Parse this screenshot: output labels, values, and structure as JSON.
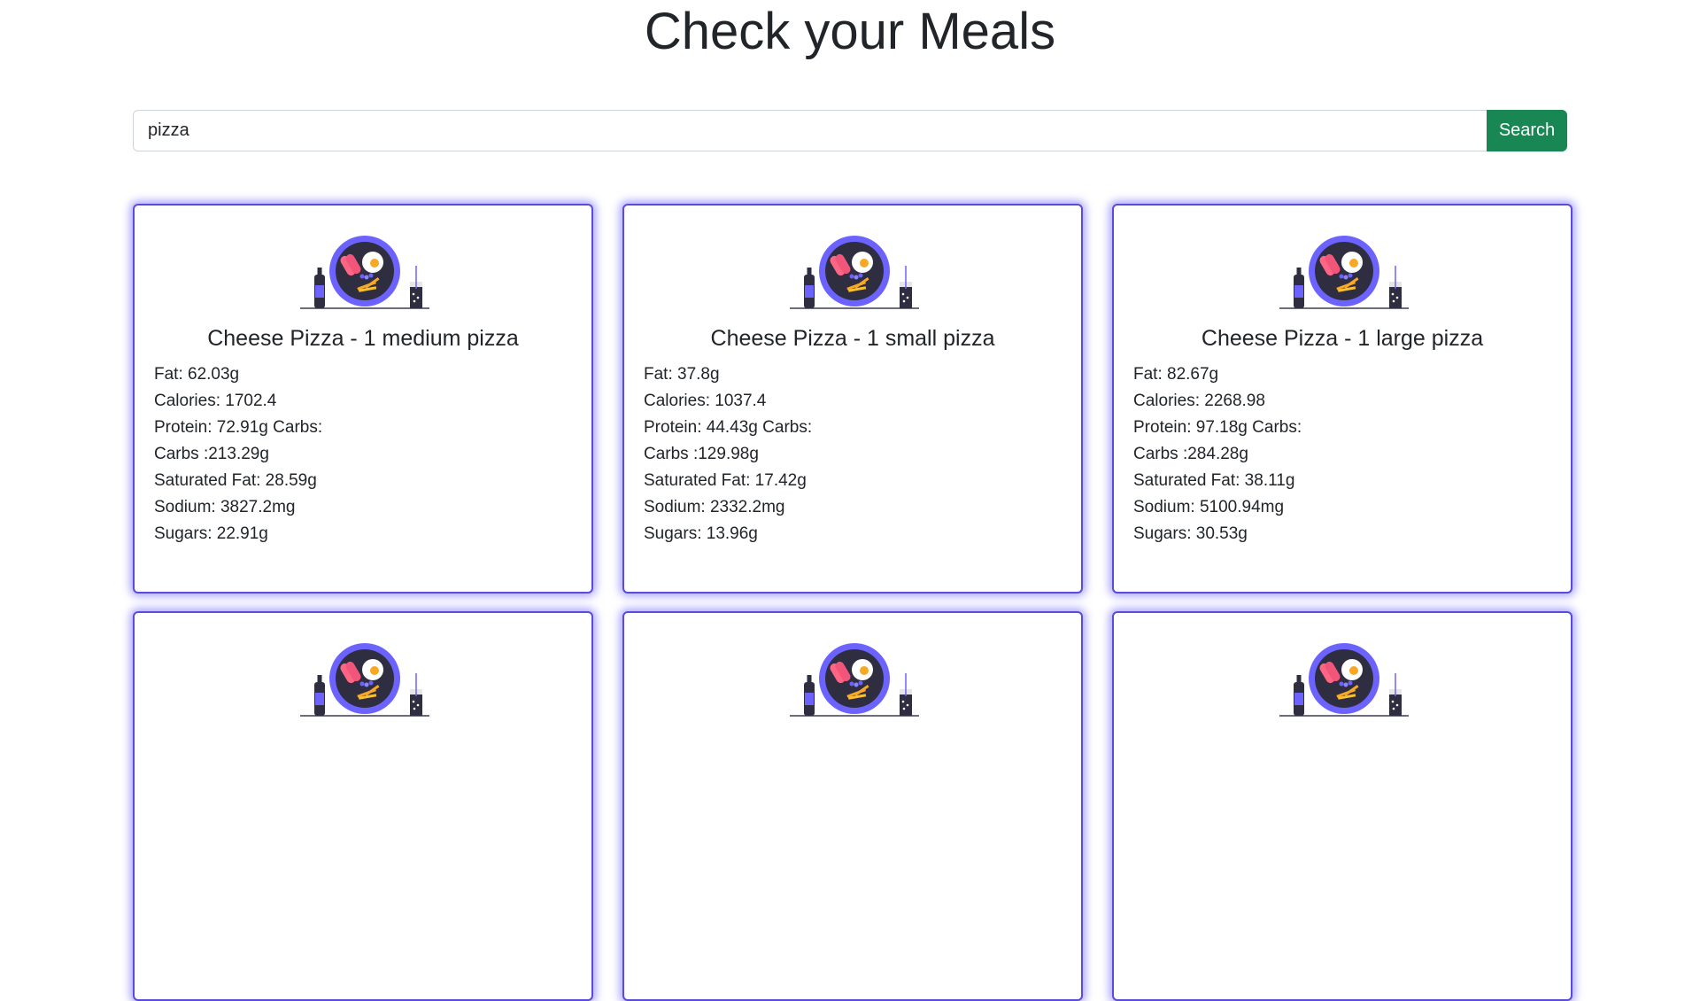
{
  "page": {
    "title": "Check your Meals"
  },
  "search": {
    "value": "pizza",
    "button_label": "Search"
  },
  "colors": {
    "search_button": "#198754",
    "card_glow": "#6c63ff",
    "plate": "#6c63ff",
    "plate_inner": "#2f2e41"
  },
  "cards": [
    {
      "title": "Cheese Pizza - 1 medium pizza",
      "illustration": "meal-plate-icon",
      "stats": [
        "Fat: 62.03g",
        "Calories: 1702.4",
        "Protein: 72.91g Carbs:",
        "Carbs :213.29g",
        "Saturated Fat: 28.59g",
        "Sodium: 3827.2mg",
        "Sugars: 22.91g"
      ]
    },
    {
      "title": "Cheese Pizza - 1 small pizza",
      "illustration": "meal-plate-icon",
      "stats": [
        "Fat: 37.8g",
        "Calories: 1037.4",
        "Protein: 44.43g Carbs:",
        "Carbs :129.98g",
        "Saturated Fat: 17.42g",
        "Sodium: 2332.2mg",
        "Sugars: 13.96g"
      ]
    },
    {
      "title": "Cheese Pizza - 1 large pizza",
      "illustration": "meal-plate-icon",
      "stats": [
        "Fat: 82.67g",
        "Calories: 2268.98",
        "Protein: 97.18g Carbs:",
        "Carbs :284.28g",
        "Saturated Fat: 38.11g",
        "Sodium: 5100.94mg",
        "Sugars: 30.53g"
      ]
    },
    {
      "illustration": "meal-plate-icon"
    },
    {
      "illustration": "meal-plate-icon"
    },
    {
      "illustration": "meal-plate-icon"
    }
  ]
}
